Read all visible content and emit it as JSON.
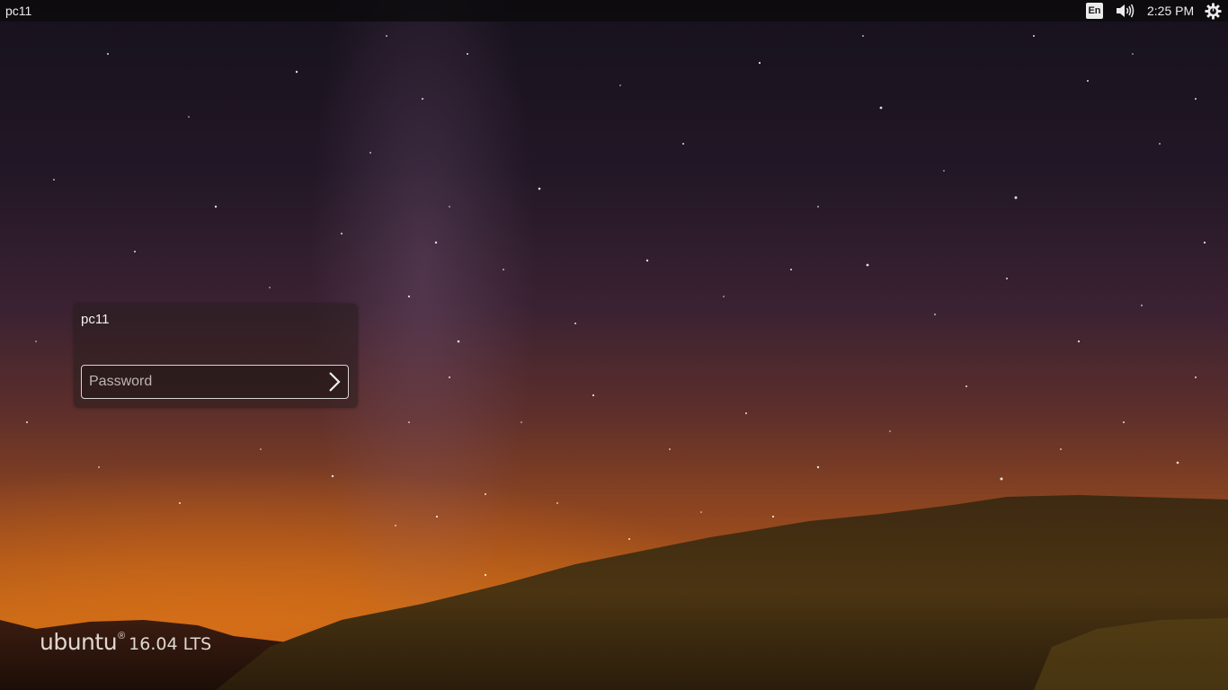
{
  "top_panel": {
    "hostname": "pc11",
    "keyboard_layout": "En",
    "volume_icon": "speaker-volume-icon",
    "clock": "2:25 PM",
    "power_icon": "gear-power-icon"
  },
  "greeter": {
    "username": "pc11",
    "password_placeholder": "Password",
    "password_value": "",
    "submit_icon": "chevron-right-icon"
  },
  "branding": {
    "name": "ubuntu",
    "mark": "®",
    "version": "16.04 LTS"
  },
  "colors": {
    "panel_bg": "#0c0a0c",
    "text_light": "#ececec",
    "field_border": "#d9d4d2",
    "sky_top": "#17111d",
    "horizon_orange": "#c46a14"
  }
}
